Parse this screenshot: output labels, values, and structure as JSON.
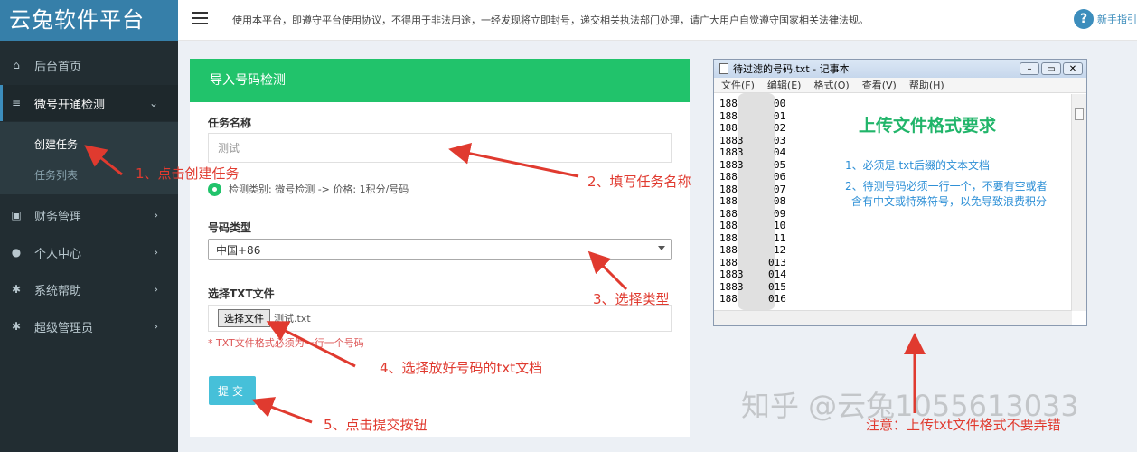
{
  "brand": "云兔软件平台",
  "topbar": {
    "notice": "使用本平台，即遵守平台使用协议，不得用于非法用途，一经发现将立即封号，递交相关执法部门处理，请广大用户自觉遵守国家相关法律法规。",
    "help_icon": "?",
    "help_label": "新手指引"
  },
  "sidebar": {
    "items": [
      {
        "label": "后台首页",
        "icon": "home-icon"
      },
      {
        "label": "微号开通检测",
        "icon": "list-icon"
      },
      {
        "label": "财务管理",
        "icon": "wallet-icon"
      },
      {
        "label": "个人中心",
        "icon": "user-icon"
      },
      {
        "label": "系统帮助",
        "icon": "gear-icon"
      },
      {
        "label": "超级管理员",
        "icon": "gear-icon"
      }
    ],
    "submenu": [
      "创建任务",
      "任务列表"
    ]
  },
  "form": {
    "title": "导入号码检测",
    "task_name_label": "任务名称",
    "task_name_placeholder": "测试",
    "radio_text": "检测类别:  微号检测 -> 价格: 1积分/号码",
    "number_type_label": "号码类型",
    "number_type_value": "中国+86",
    "file_label": "选择TXT文件",
    "file_button": "选择文件",
    "file_name": "测试.txt",
    "hint": "* TXT文件格式必须为一行一个号码",
    "submit": "提交"
  },
  "notepad": {
    "title": "待过滤的号码.txt - 记事本",
    "menu": [
      "文件(F)",
      "编辑(E)",
      "格式(O)",
      "查看(V)",
      "帮助(H)"
    ],
    "lines": [
      {
        "pre": "188",
        "suf": "00"
      },
      {
        "pre": "188",
        "suf": "01"
      },
      {
        "pre": "188",
        "suf": "02"
      },
      {
        "pre": "1883",
        "suf": "03"
      },
      {
        "pre": "1883",
        "suf": "04"
      },
      {
        "pre": "1883",
        "suf": "05"
      },
      {
        "pre": "188",
        "suf": "06"
      },
      {
        "pre": "188",
        "suf": "07"
      },
      {
        "pre": "188",
        "suf": "08"
      },
      {
        "pre": "188",
        "suf": "09"
      },
      {
        "pre": "188",
        "suf": "10"
      },
      {
        "pre": "188",
        "suf": "11"
      },
      {
        "pre": "188",
        "suf": "12"
      },
      {
        "pre": "188",
        "suf": "013"
      },
      {
        "pre": "1883",
        "suf": "014"
      },
      {
        "pre": "1883",
        "suf": "015"
      },
      {
        "pre": "188",
        "suf": "016"
      }
    ],
    "heading": "上传文件格式要求",
    "rule1": "1、必须是.txt后缀的文本文档",
    "rule2a": "2、待测号码必须一行一个，不要有空或者",
    "rule2b": "含有中文或特殊符号，以免导致浪费积分"
  },
  "annotations": {
    "a1": "1、点击创建任务",
    "a2": "2、填写任务名称",
    "a3": "3、选择类型",
    "a4": "4、选择放好号码的txt文档",
    "a5": "5、点击提交按钮",
    "a6": "注意：上传txt文件格式不要弄错"
  },
  "watermark": "知乎 @云兔1055613033",
  "colors": {
    "sidebar": "#222d32",
    "brand": "#367fa9",
    "panel_header": "#21c36b",
    "submit": "#46c0d9",
    "annotation": "#e03a2f"
  }
}
